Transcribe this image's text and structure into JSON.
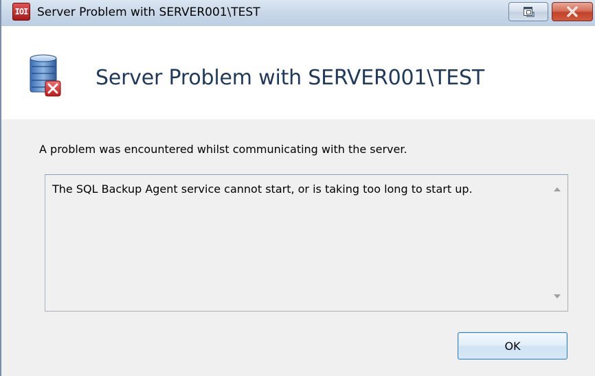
{
  "window": {
    "title": "Server Problem with SERVER001\\TEST",
    "app_icon_text": "IOI",
    "controls": [
      "restore-icon",
      "close-icon"
    ]
  },
  "header": {
    "icon": "server-error-icon",
    "title": "Server Problem with SERVER001\\TEST"
  },
  "body": {
    "message": "A problem was encountered whilst communicating with the server.",
    "details": "The SQL Backup Agent service cannot start, or is taking too long to start up."
  },
  "buttons": {
    "ok_label": "OK"
  },
  "colors": {
    "header_title": "#1e395b",
    "close_button": "#c1422a",
    "ok_border": "#3c7fb1"
  }
}
